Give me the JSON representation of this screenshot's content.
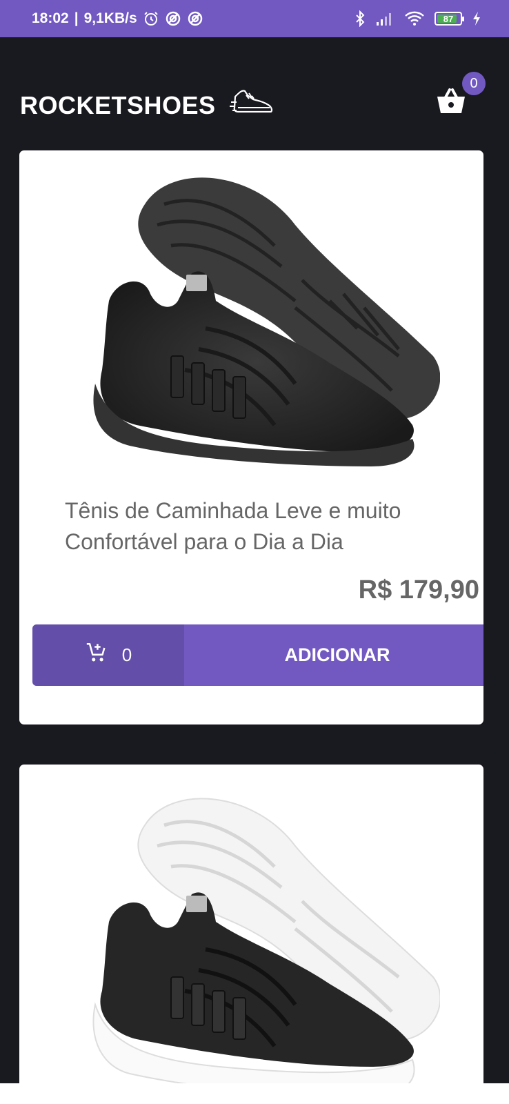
{
  "status_bar": {
    "time": "18:02",
    "network_speed": "9,1KB/s",
    "battery_level": "87",
    "battery_percent": 87,
    "icons": [
      "alarm-icon",
      "data-saver-icon",
      "data-saver-icon",
      "bluetooth-icon",
      "signal-icon",
      "wifi-icon",
      "battery-icon",
      "charging-icon"
    ]
  },
  "header": {
    "brand": "ROCKETSHOES",
    "logo_icon": "running-shoe-icon",
    "cart_icon": "basket-icon",
    "cart_count": "0"
  },
  "products": [
    {
      "title": "Tênis de Caminhada Leve e muito Confortável para o Dia a Dia",
      "price": "R$ 179,90",
      "amount_in_cart": "0",
      "add_label": "ADICIONAR",
      "cart_icon": "add-shopping-cart-icon",
      "image": "black-sneaker"
    },
    {
      "image": "black-sneaker-white-sole"
    }
  ],
  "colors": {
    "accent": "#7159c1",
    "background": "#191920",
    "card": "#ffffff",
    "text": "#666666"
  }
}
